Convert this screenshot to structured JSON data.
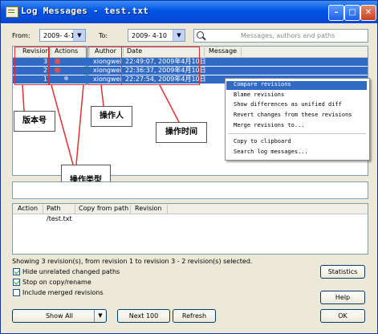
{
  "window": {
    "title": "Log Messages - test.txt"
  },
  "filters": {
    "from_label": "From:",
    "from_date": "2009- 4-10",
    "to_label": "To:",
    "to_date": "2009- 4-10",
    "search_placeholder": "Messages, authors and paths"
  },
  "log_list": {
    "columns": [
      "Revision",
      "Actions",
      "Author",
      "Date",
      "Message"
    ],
    "rows": [
      {
        "revision": "3",
        "author": "xiongwei",
        "date": "22:49:07, 2009年4月10日",
        "message": ""
      },
      {
        "revision": "2",
        "author": "xiongwei",
        "date": "22:36:37, 2009年4月10日",
        "message": ""
      },
      {
        "revision": "1",
        "author": "xiongwei",
        "date": "22:27:54, 2009年4月10日",
        "message": ""
      }
    ]
  },
  "context_menu": {
    "items": [
      "Compare revisions",
      "Blame revisions",
      "Show differences as unified diff",
      "Revert changes from these revisions",
      "Merge revisions to...",
      "Copy to clipboard",
      "Search log messages..."
    ]
  },
  "annotations": {
    "revision_number": "版本号",
    "operator": "操作人",
    "operation_time": "操作时间",
    "operation_type": "操作类型"
  },
  "paths": {
    "columns": [
      "Action",
      "Path",
      "Copy from path",
      "Revision"
    ],
    "rows": [
      {
        "action": "",
        "path": "/test.txt",
        "copy_from": "",
        "revision": ""
      }
    ]
  },
  "status_text": "Showing 3 revision(s), from revision 1 to revision 3 - 2 revision(s) selected.",
  "options": {
    "hide_unrelated": {
      "label": "Hide unrelated changed paths",
      "checked": true
    },
    "stop_on_copy": {
      "label": "Stop on copy/rename",
      "checked": true
    },
    "include_merged": {
      "label": "Include merged revisions",
      "checked": false
    }
  },
  "buttons": {
    "show_all": "Show All",
    "next_100": "Next 100",
    "refresh": "Refresh",
    "statistics": "Statistics",
    "help": "Help",
    "ok": "OK"
  },
  "colors": {
    "selection": "#316ac5",
    "annotation_border": "#e23030",
    "titlebar": "#0054e3"
  }
}
